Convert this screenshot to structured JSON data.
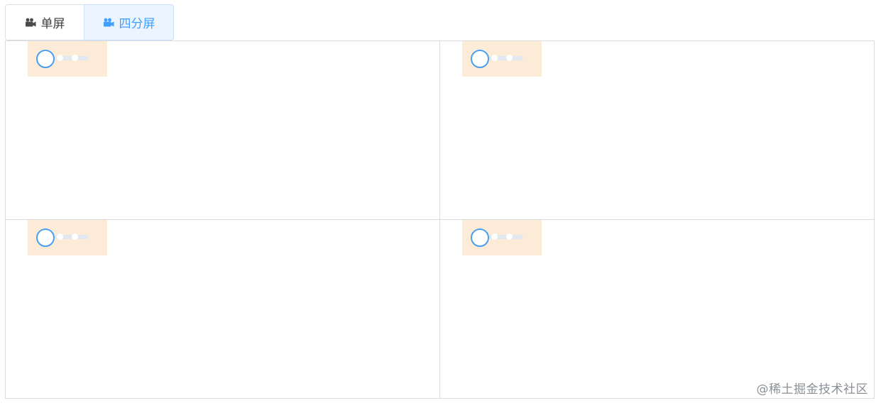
{
  "tabs": {
    "single": {
      "label": "单屏",
      "icon": "video-camera-icon"
    },
    "quad": {
      "label": "四分屏",
      "icon": "video-camera-icon"
    },
    "active": "quad"
  },
  "players": [
    {
      "status_icon": "loading-spinner-icon"
    },
    {
      "status_icon": "loading-spinner-icon"
    },
    {
      "status_icon": "loading-spinner-icon"
    },
    {
      "status_icon": "loading-spinner-icon"
    }
  ],
  "colors": {
    "accent": "#409eff",
    "active_tab_bg": "#ecf5ff",
    "loader_bg": "#fcebd6",
    "border": "#dcdcdc"
  },
  "watermark": "@稀土掘金技术社区"
}
